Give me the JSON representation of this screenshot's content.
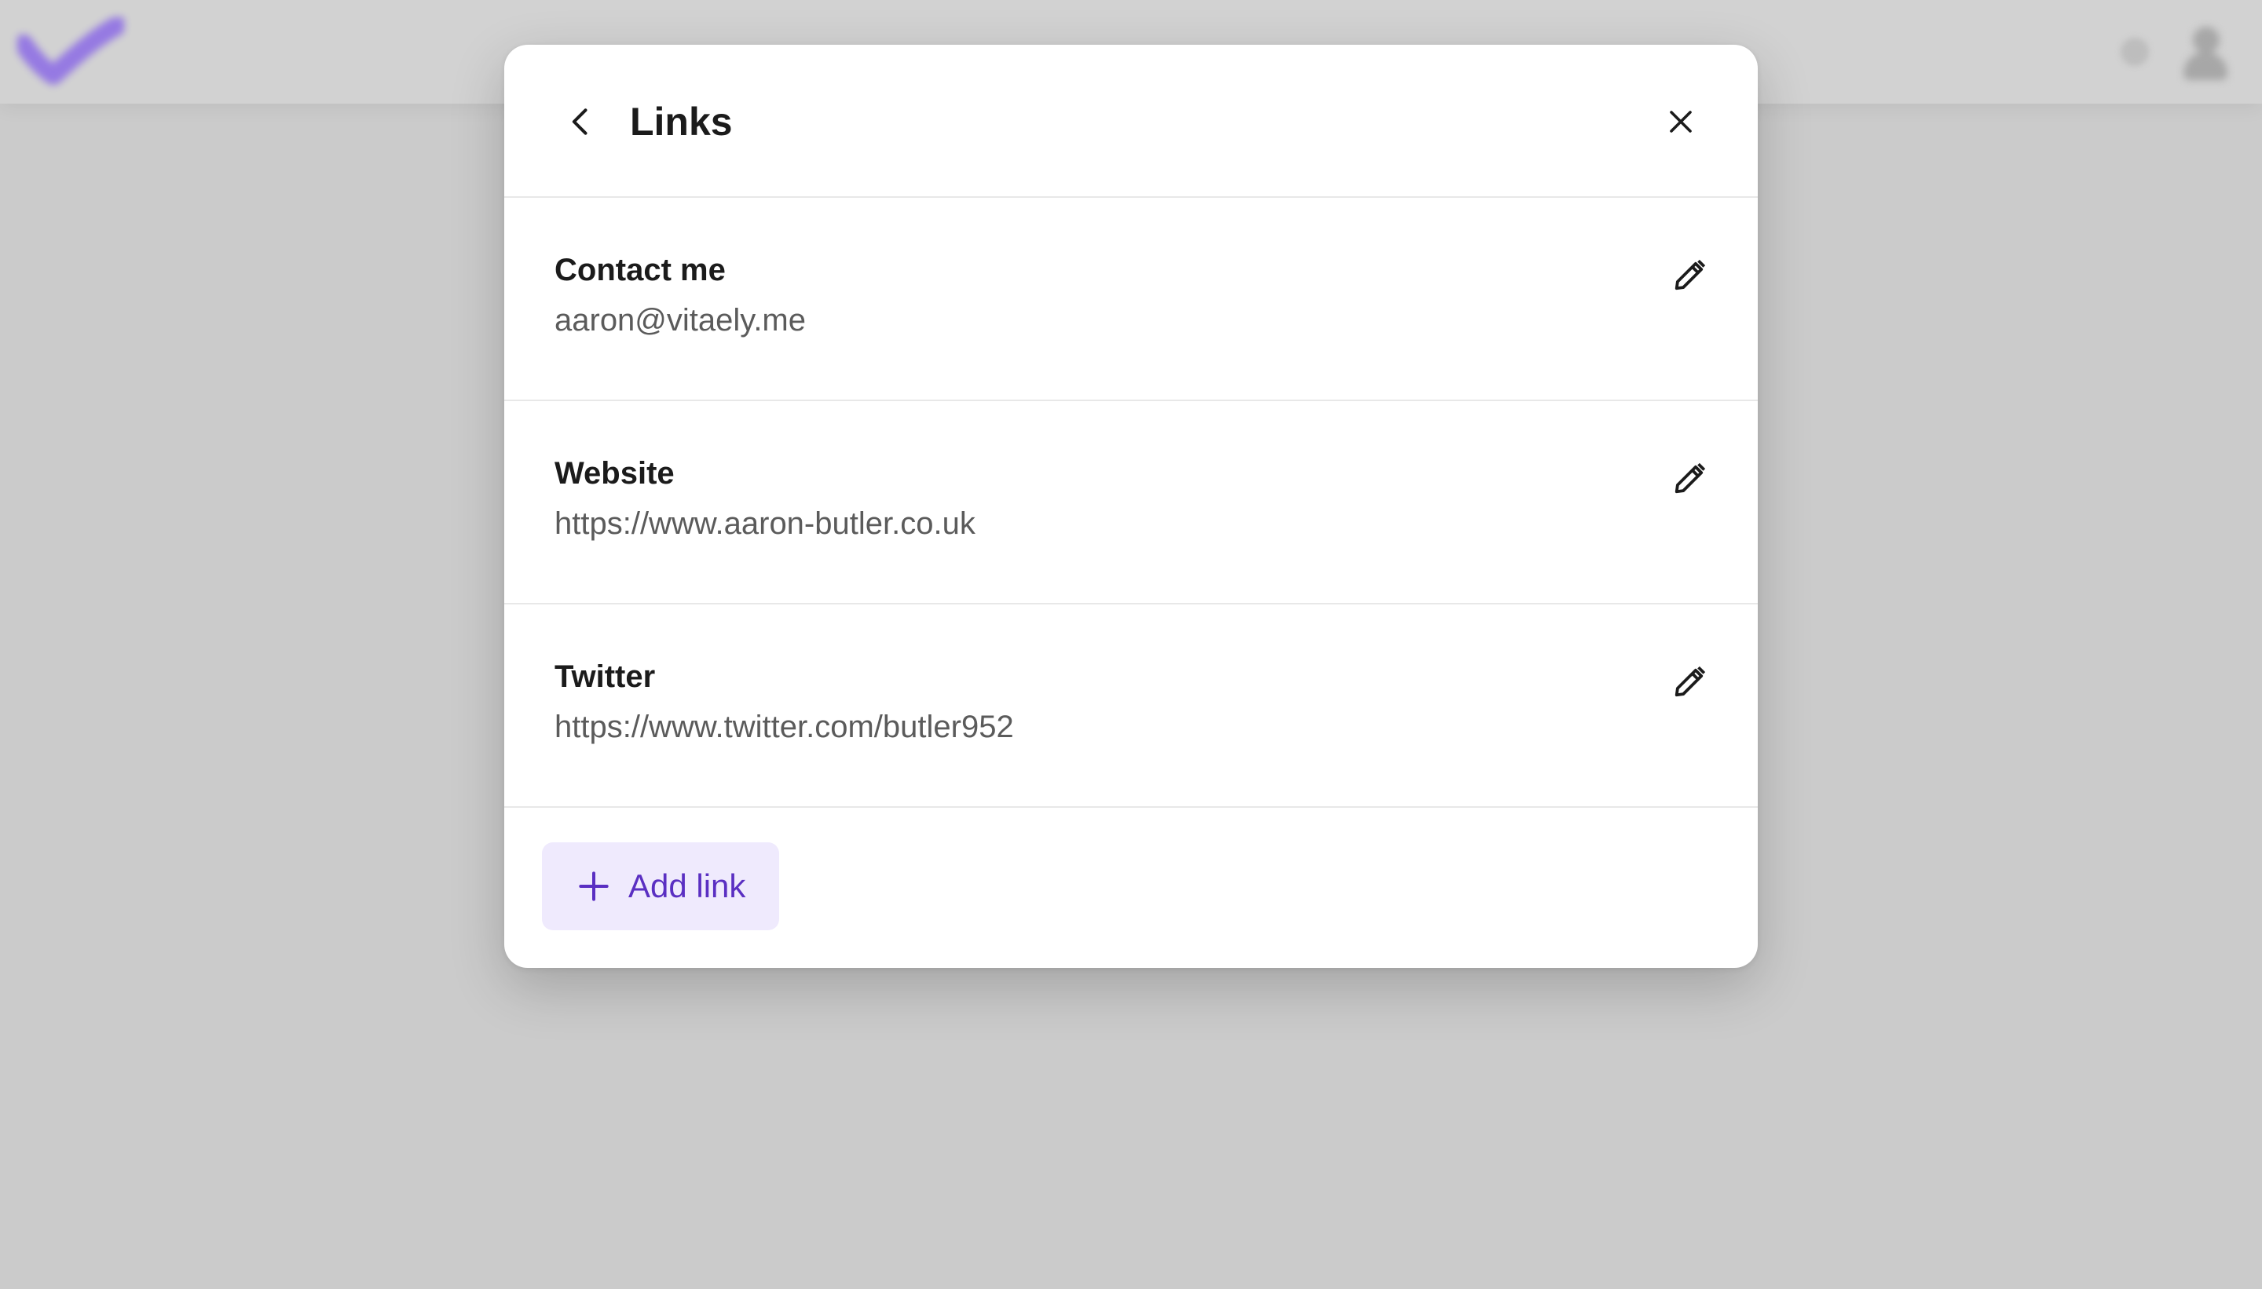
{
  "colors": {
    "overlay": "#cbcbcb",
    "brand": "#8b6ae6",
    "accent_text": "#5a2fc2",
    "accent_bg": "#efeafd"
  },
  "background": {
    "logo_icon": "checkmark-logo-icon",
    "avatar_icon": "user-avatar-icon"
  },
  "modal": {
    "title": "Links",
    "back_icon": "chevron-left-icon",
    "close_icon": "close-icon",
    "links": [
      {
        "label": "Contact me",
        "value": "aaron@vitaely.me",
        "edit_icon": "pencil-icon"
      },
      {
        "label": "Website",
        "value": "https://www.aaron-butler.co.uk",
        "edit_icon": "pencil-icon"
      },
      {
        "label": "Twitter",
        "value": "https://www.twitter.com/butler952",
        "edit_icon": "pencil-icon"
      }
    ],
    "add_button": {
      "label": "Add link",
      "icon": "plus-icon"
    }
  }
}
